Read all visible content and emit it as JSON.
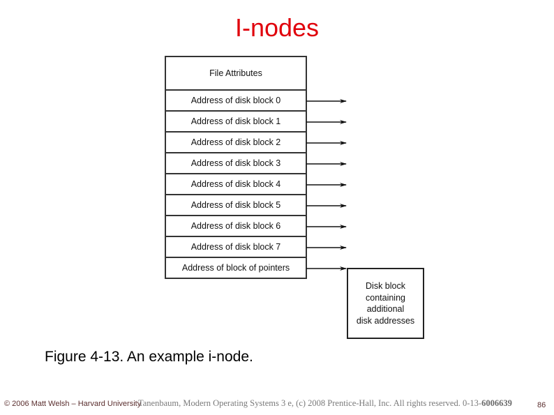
{
  "slide": {
    "title": "I-nodes",
    "caption": "Figure 4-13. An example i-node.",
    "footer_left": "© 2006 Matt Welsh – Harvard University",
    "footer_overlay_prefix": "Tanenbaum, Modern Operating Systems 3 e, (c) 2008 Prentice-Hall, Inc. All rights reserved. 0-13-",
    "footer_overlay_isbn_bold": "6006639",
    "page_number": "86"
  },
  "inode": {
    "header": "File Attributes",
    "rows": [
      {
        "label": "Address of disk block 0",
        "has_arrow": true
      },
      {
        "label": "Address of disk block 1",
        "has_arrow": true
      },
      {
        "label": "Address of disk block 2",
        "has_arrow": true
      },
      {
        "label": "Address of disk block 3",
        "has_arrow": true
      },
      {
        "label": "Address of disk block 4",
        "has_arrow": true
      },
      {
        "label": "Address of disk block 5",
        "has_arrow": true
      },
      {
        "label": "Address of disk block 6",
        "has_arrow": true
      },
      {
        "label": "Address of disk block 7",
        "has_arrow": true
      },
      {
        "label": "Address of block of pointers",
        "has_arrow": true,
        "points_to": "indirect_block"
      }
    ]
  },
  "indirect_block": {
    "lines": [
      "Disk block",
      "containing",
      "additional",
      "disk addresses"
    ]
  },
  "colors": {
    "title": "#e0000b",
    "lines": "#333333",
    "footer": "#5a2e2e"
  }
}
